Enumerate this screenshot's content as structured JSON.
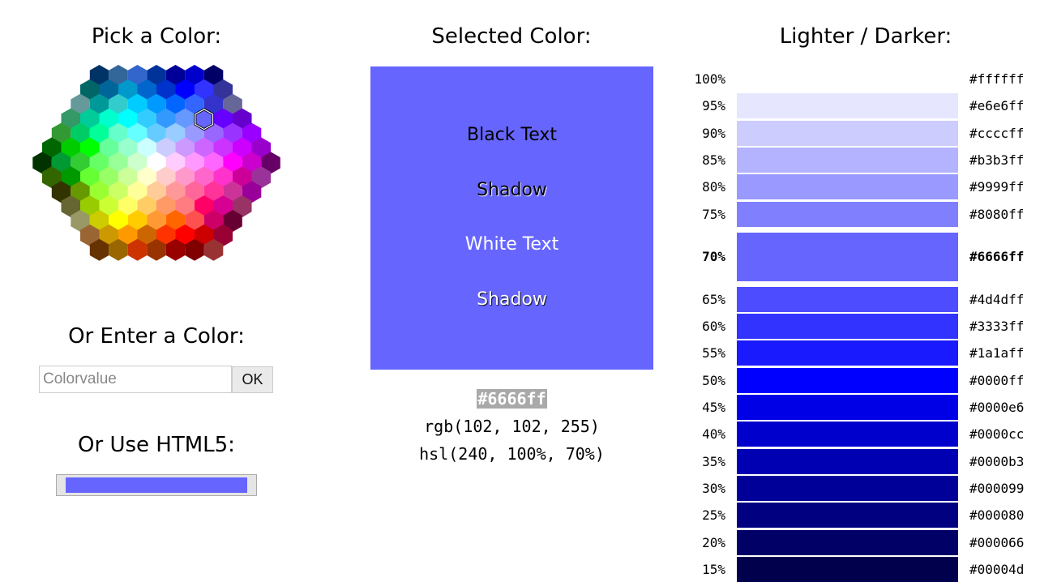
{
  "picker": {
    "title": "Pick a Color:"
  },
  "enter": {
    "title": "Or Enter a Color:",
    "placeholder": "Colorvalue",
    "ok_label": "OK"
  },
  "html5": {
    "title": "Or Use HTML5:",
    "value": "#6666ff"
  },
  "selected": {
    "title": "Selected Color:",
    "color": "#6666ff",
    "black_text": "Black Text",
    "black_shadow": "Shadow",
    "white_text": "White Text",
    "white_shadow": "Shadow",
    "hex": "#6666ff",
    "rgb": "rgb(102, 102, 255)",
    "hsl": "hsl(240, 100%, 70%)"
  },
  "shades": {
    "title": "Lighter / Darker:",
    "selected_index": 6,
    "rows": [
      {
        "pct": "100%",
        "hex": "#ffffff"
      },
      {
        "pct": "95%",
        "hex": "#e6e6ff"
      },
      {
        "pct": "90%",
        "hex": "#ccccff"
      },
      {
        "pct": "85%",
        "hex": "#b3b3ff"
      },
      {
        "pct": "80%",
        "hex": "#9999ff"
      },
      {
        "pct": "75%",
        "hex": "#8080ff"
      },
      {
        "pct": "70%",
        "hex": "#6666ff"
      },
      {
        "pct": "65%",
        "hex": "#4d4dff"
      },
      {
        "pct": "60%",
        "hex": "#3333ff"
      },
      {
        "pct": "55%",
        "hex": "#1a1aff"
      },
      {
        "pct": "50%",
        "hex": "#0000ff"
      },
      {
        "pct": "45%",
        "hex": "#0000e6"
      },
      {
        "pct": "40%",
        "hex": "#0000cc"
      },
      {
        "pct": "35%",
        "hex": "#0000b3"
      },
      {
        "pct": "30%",
        "hex": "#000099"
      },
      {
        "pct": "25%",
        "hex": "#000080"
      },
      {
        "pct": "20%",
        "hex": "#000066"
      },
      {
        "pct": "15%",
        "hex": "#00004d"
      }
    ]
  },
  "hex_palette": [
    [
      "#003366",
      "#336699",
      "#3366CC",
      "#003399",
      "#000099",
      "#0000CC",
      "#000066"
    ],
    [
      "#006666",
      "#006699",
      "#0099CC",
      "#0066CC",
      "#0033CC",
      "#0000FF",
      "#3333FF",
      "#333399"
    ],
    [
      "#669999",
      "#009999",
      "#33CCCC",
      "#00CCFF",
      "#0099FF",
      "#0066FF",
      "#3366FF",
      "#3333CC",
      "#666699"
    ],
    [
      "#339966",
      "#00CC99",
      "#00FFCC",
      "#00FFFF",
      "#33CCFF",
      "#3399FF",
      "#6699FF",
      "#6666FF",
      "#6600FF",
      "#6600CC"
    ],
    [
      "#339933",
      "#00CC66",
      "#00FF99",
      "#66FFCC",
      "#66FFFF",
      "#66CCFF",
      "#99CCFF",
      "#9999FF",
      "#9966FF",
      "#9933FF",
      "#9900FF"
    ],
    [
      "#006600",
      "#00CC00",
      "#00FF00",
      "#66FF99",
      "#99FFCC",
      "#CCFFFF",
      "#CCCCFF",
      "#CC99FF",
      "#CC66FF",
      "#CC33FF",
      "#CC00FF",
      "#9900CC"
    ],
    [
      "#003300",
      "#009933",
      "#33CC33",
      "#66FF66",
      "#99FF99",
      "#CCFFCC",
      "#FFFFFF",
      "#FFCCFF",
      "#FF99FF",
      "#FF66FF",
      "#FF00FF",
      "#CC00CC",
      "#660066"
    ],
    [
      "#336600",
      "#009900",
      "#66FF33",
      "#99FF66",
      "#CCFF99",
      "#FFFFCC",
      "#FFCCCC",
      "#FF99CC",
      "#FF66CC",
      "#FF33CC",
      "#CC0099",
      "#993399"
    ],
    [
      "#333300",
      "#669900",
      "#99FF33",
      "#CCFF66",
      "#FFFF99",
      "#FFCC99",
      "#FF9999",
      "#FF6699",
      "#FF3399",
      "#CC3399",
      "#990099"
    ],
    [
      "#666633",
      "#99CC00",
      "#CCFF33",
      "#FFFF66",
      "#FFCC66",
      "#FF9966",
      "#FF7C80",
      "#FF0066",
      "#D60093",
      "#993366"
    ],
    [
      "#999966",
      "#CCCC00",
      "#FFFF00",
      "#FFCC00",
      "#FF9933",
      "#FF6600",
      "#FF5050",
      "#CC0066",
      "#660033"
    ],
    [
      "#996633",
      "#CC9900",
      "#FF9900",
      "#CC6600",
      "#FF3300",
      "#FF0000",
      "#CC0000",
      "#990033"
    ],
    [
      "#663300",
      "#996600",
      "#CC3300",
      "#993300",
      "#990000",
      "#800000",
      "#993333"
    ]
  ]
}
